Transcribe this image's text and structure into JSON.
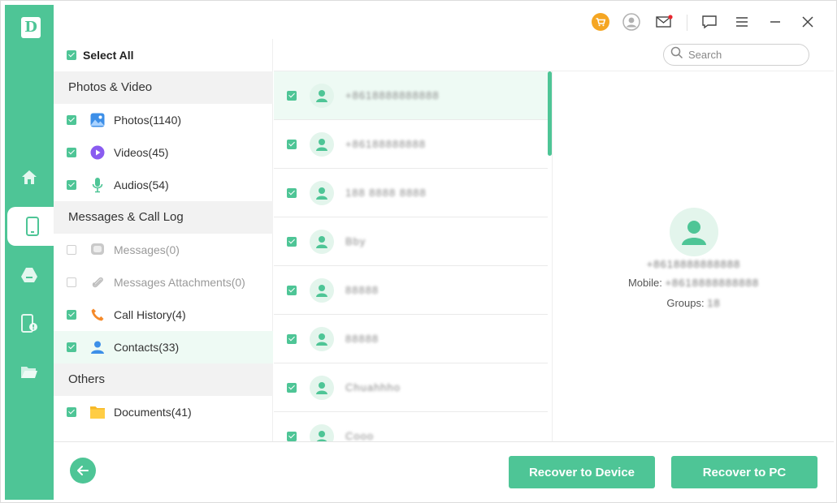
{
  "app": {
    "logo_letter": "D",
    "accent_color": "#4ec596"
  },
  "rail": {
    "items": [
      {
        "name": "home-icon"
      },
      {
        "name": "phone-icon",
        "active": true
      },
      {
        "name": "google-drive-icon"
      },
      {
        "name": "phone-repair-icon"
      },
      {
        "name": "folder-icon"
      }
    ]
  },
  "titlebar": {
    "icons": [
      "cart-icon",
      "account-icon",
      "mail-icon",
      "feedback-icon",
      "menu-icon",
      "minimize-icon",
      "close-icon"
    ]
  },
  "categories": {
    "select_all_label": "Select All",
    "groups": [
      {
        "header": "Photos & Video",
        "items": [
          {
            "label": "Photos(1140)",
            "icon": "photos-icon",
            "checked": true
          },
          {
            "label": "Videos(45)",
            "icon": "videos-icon",
            "checked": true
          },
          {
            "label": "Audios(54)",
            "icon": "microphone-icon",
            "checked": true
          }
        ]
      },
      {
        "header": "Messages & Call Log",
        "items": [
          {
            "label": "Messages(0)",
            "icon": "message-icon",
            "checked": false,
            "disabled": true
          },
          {
            "label": "Messages Attachments(0)",
            "icon": "paperclip-icon",
            "checked": false,
            "disabled": true
          },
          {
            "label": "Call History(4)",
            "icon": "phone-call-icon",
            "checked": true
          },
          {
            "label": "Contacts(33)",
            "icon": "contact-icon",
            "checked": true,
            "selected": true
          }
        ]
      },
      {
        "header": "Others",
        "items": [
          {
            "label": "Documents(41)",
            "icon": "documents-icon",
            "checked": true
          }
        ]
      }
    ]
  },
  "search": {
    "placeholder": "Search"
  },
  "contacts": {
    "rows": [
      {
        "name": "+8618888888888",
        "checked": true,
        "selected": true
      },
      {
        "name": "+86188888888",
        "checked": true
      },
      {
        "name": "188 8888 8888",
        "checked": true
      },
      {
        "name": "Bby",
        "checked": true
      },
      {
        "name": "88888",
        "checked": true
      },
      {
        "name": "88888",
        "checked": true
      },
      {
        "name": "Chuahhho",
        "checked": true
      },
      {
        "name": "Cooo",
        "checked": true
      }
    ]
  },
  "detail": {
    "phone": "+8618888888888",
    "mobile_label": "Mobile: ",
    "mobile_value": "+8618888888888",
    "groups_label": "Groups: ",
    "groups_value": "18"
  },
  "footer": {
    "recover_device_label": "Recover to Device",
    "recover_pc_label": "Recover to PC"
  }
}
